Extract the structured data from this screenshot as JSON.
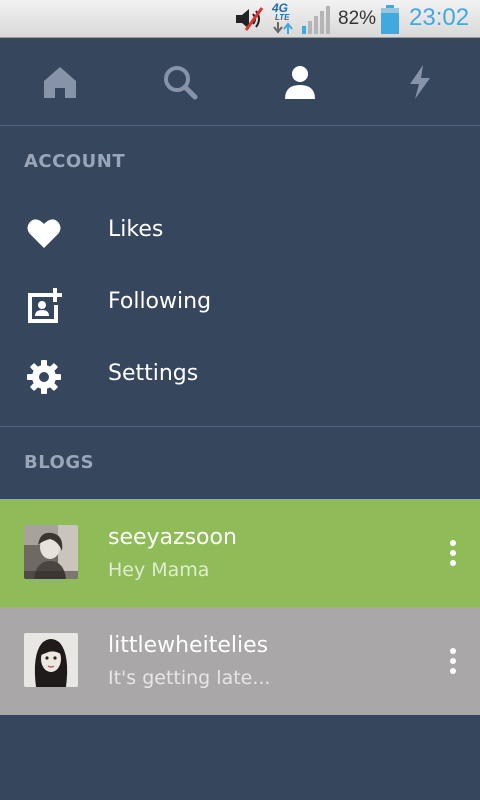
{
  "status_bar": {
    "network_label": "4G",
    "network_sub": "LTE",
    "battery_percent": "82%",
    "battery_level": 0.82,
    "time": "23:02",
    "icons": [
      "volume-muted-icon",
      "network-4g-lte-icon",
      "signal-strength-icon",
      "battery-icon"
    ]
  },
  "tabs": [
    {
      "name": "home",
      "icon": "home-icon",
      "active": false
    },
    {
      "name": "search",
      "icon": "search-icon",
      "active": false
    },
    {
      "name": "account",
      "icon": "person-icon",
      "active": true
    },
    {
      "name": "activity",
      "icon": "lightning-icon",
      "active": false
    }
  ],
  "account": {
    "header": "ACCOUNT",
    "items": [
      {
        "label": "Likes",
        "icon": "heart-icon"
      },
      {
        "label": "Following",
        "icon": "add-contact-icon"
      },
      {
        "label": "Settings",
        "icon": "gear-icon"
      }
    ]
  },
  "blogs": {
    "header": "BLOGS",
    "items": [
      {
        "name": "seeyazsoon",
        "title": "Hey Mama",
        "color": "#8fbc58"
      },
      {
        "name": "littlewheitelies",
        "title": "It's getting late...",
        "color": "#a9a7a8"
      }
    ]
  },
  "colors": {
    "background": "#36465d",
    "tab_inactive": "#8794a7",
    "tab_active": "#ffffff",
    "accent_time": "#3fa9e0"
  }
}
